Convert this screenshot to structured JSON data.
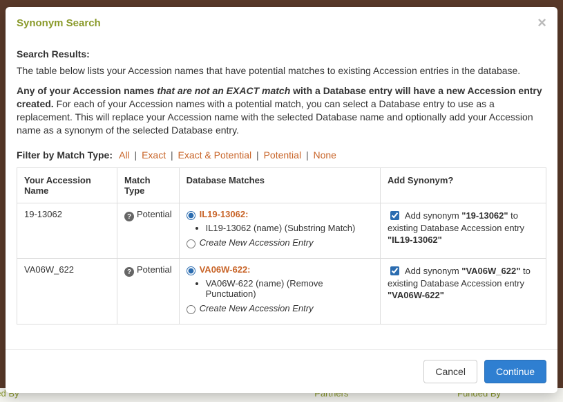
{
  "modal": {
    "title": "Synonym Search",
    "close_label": "×"
  },
  "results": {
    "heading": "Search Results:",
    "desc": "The table below lists your Accession names that have potential matches to existing Accession entries in the database.",
    "warn_lead": "Any of your Accession names ",
    "warn_em": "that are not an EXACT match",
    "warn_tail_bold": " with a Database entry will have a new Accession entry created.",
    "warn_rest": " For each of your Accession names with a potential match, you can select a Database entry to use as a replacement. This will replace your Accession name with the selected Database name and optionally add your Accession name as a synonym of the selected Database entry."
  },
  "filter": {
    "label": "Filter by Match Type:",
    "options": [
      "All",
      "Exact",
      "Exact & Potential",
      "Potential",
      "None"
    ]
  },
  "table": {
    "headers": {
      "your_name": "Your Accession Name",
      "match_type": "Match Type",
      "db_matches": "Database Matches",
      "add_synonym": "Add Synonym?"
    },
    "create_new_label": "Create New Accession Entry",
    "syn_prefix": "Add synonym ",
    "syn_middle": " to existing Database Accession entry ",
    "rows": [
      {
        "your_name": "19-13062",
        "match_type": "Potential",
        "match_name": "IL19-13062:",
        "match_detail": "IL19-13062 (name) (Substring Match)",
        "syn_your": "\"19-13062\"",
        "syn_db": "\"IL19-13062\""
      },
      {
        "your_name": "VA06W_622",
        "match_type": "Potential",
        "match_name": "VA06W-622:",
        "match_detail": "VA06W-622 (name) (Remove Punctuation)",
        "syn_your": "\"VA06W_622\"",
        "syn_db": "\"VA06W-622\""
      }
    ]
  },
  "footer": {
    "cancel": "Cancel",
    "continue": "Continue"
  },
  "backdrop": {
    "left": "red By",
    "center": "Partners",
    "right": "Funded By"
  }
}
